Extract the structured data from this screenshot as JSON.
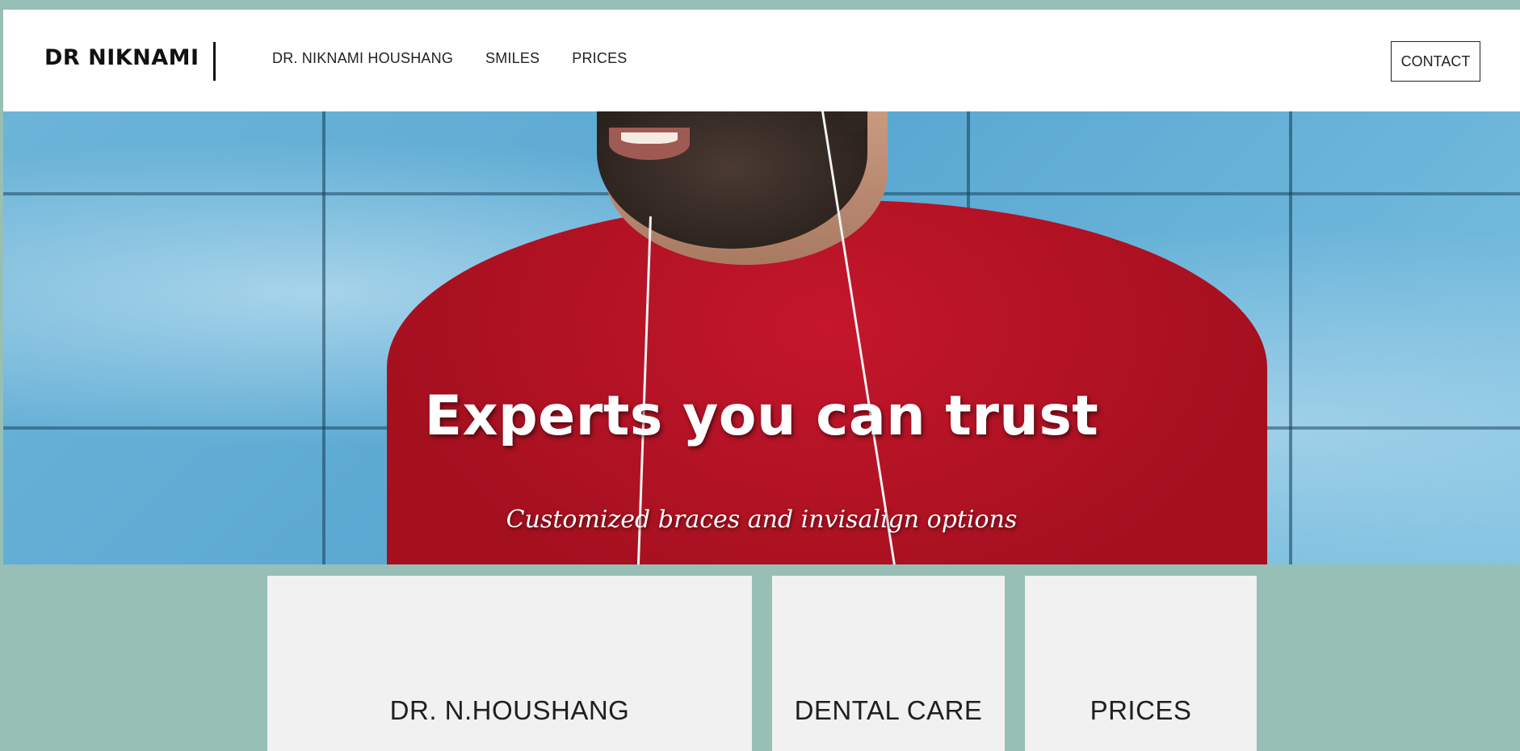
{
  "header": {
    "logo": "DR NIKNAMI",
    "nav": [
      "DR. NIKNAMI HOUSHANG",
      "SMILES",
      "PRICES"
    ],
    "contact_label": "CONTACT"
  },
  "hero": {
    "title": "Experts you can trust",
    "subtitle": "Customized braces and invisalign options"
  },
  "cards": [
    "DR. N.HOUSHANG",
    "DENTAL CARE",
    "PRICES"
  ],
  "colors": {
    "page_bg": "#97bfb6",
    "header_bg": "#ffffff",
    "card_bg": "#f1f1f1",
    "wall_blue": "#5aa8d2",
    "shirt_red": "#b3121f"
  }
}
